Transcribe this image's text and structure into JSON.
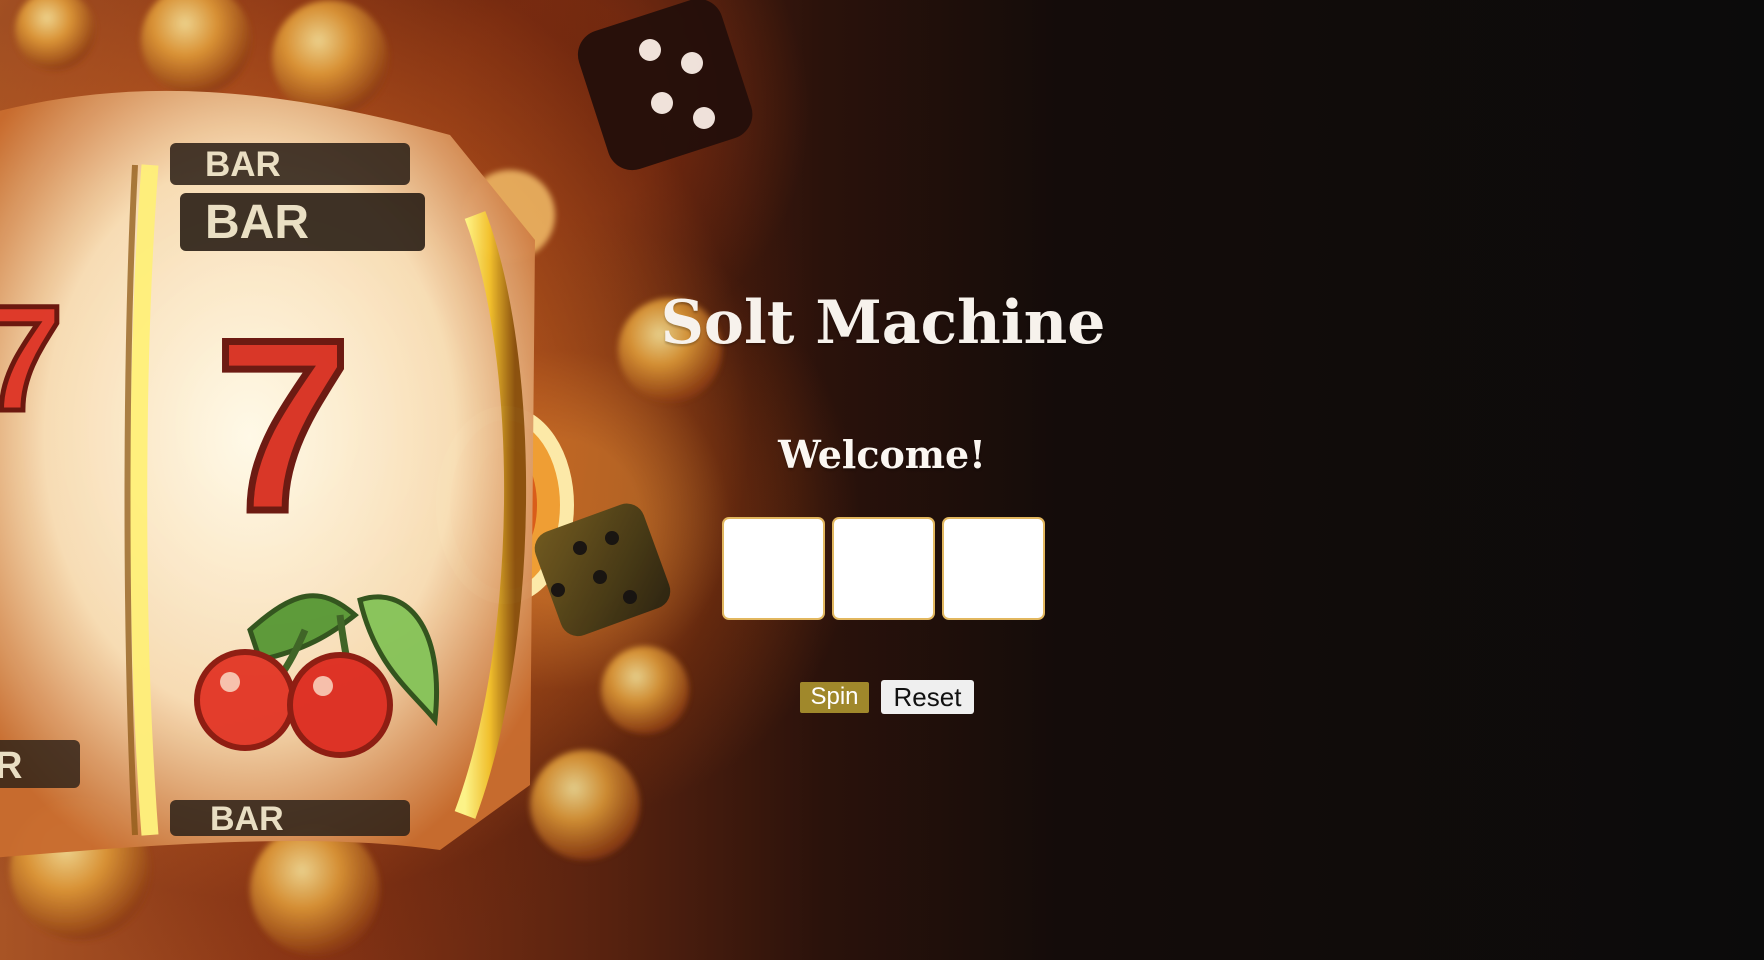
{
  "page": {
    "title": "Solt Machine",
    "welcome": "Welcome!",
    "reels": [
      "",
      "",
      ""
    ]
  },
  "controls": {
    "spin_label": "Spin",
    "reset_label": "Reset"
  },
  "theme": {
    "spin_button_color": "#a0882b",
    "reel_border_color": "#e2b75f",
    "background_dark": "#0b0b0b"
  },
  "decorative_art": {
    "symbols": [
      "BAR",
      "BAR",
      "7",
      "BAR",
      "BAR"
    ]
  }
}
